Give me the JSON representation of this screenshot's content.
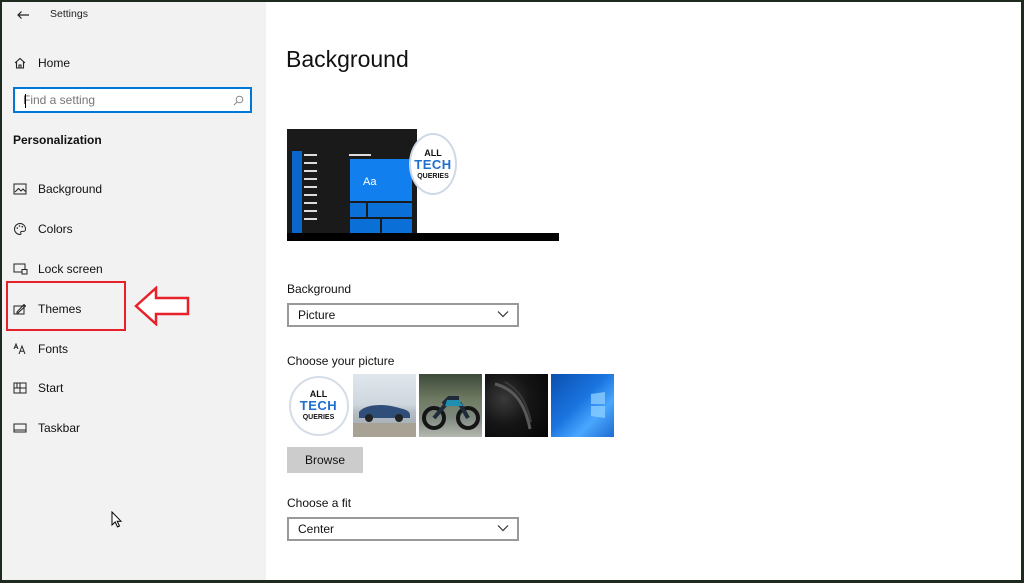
{
  "window": {
    "app_title": "Settings"
  },
  "sidebar": {
    "home_label": "Home",
    "search_placeholder": "Find a setting",
    "section_title": "Personalization",
    "items": [
      {
        "label": "Background",
        "icon": "picture-icon"
      },
      {
        "label": "Colors",
        "icon": "palette-icon"
      },
      {
        "label": "Lock screen",
        "icon": "lock-screen-icon"
      },
      {
        "label": "Themes",
        "icon": "brush-icon"
      },
      {
        "label": "Fonts",
        "icon": "fonts-icon"
      },
      {
        "label": "Start",
        "icon": "start-icon"
      },
      {
        "label": "Taskbar",
        "icon": "taskbar-icon"
      }
    ]
  },
  "main": {
    "page_title": "Background",
    "preview": {
      "tile_text": "Aa",
      "logo": {
        "line1": "ALL",
        "line2": "TECH",
        "line3": "QUERIES"
      }
    },
    "background_label": "Background",
    "background_value": "Picture",
    "choose_picture_label": "Choose your picture",
    "thumb_logo": {
      "line1": "ALL",
      "line2": "TECH",
      "line3": "QUERIES"
    },
    "browse_label": "Browse",
    "fit_label": "Choose a fit",
    "fit_value": "Center"
  },
  "colors": {
    "accent": "#0078d7",
    "annotation_red": "#e8202a",
    "sidebar_bg": "#f2f2f2"
  }
}
